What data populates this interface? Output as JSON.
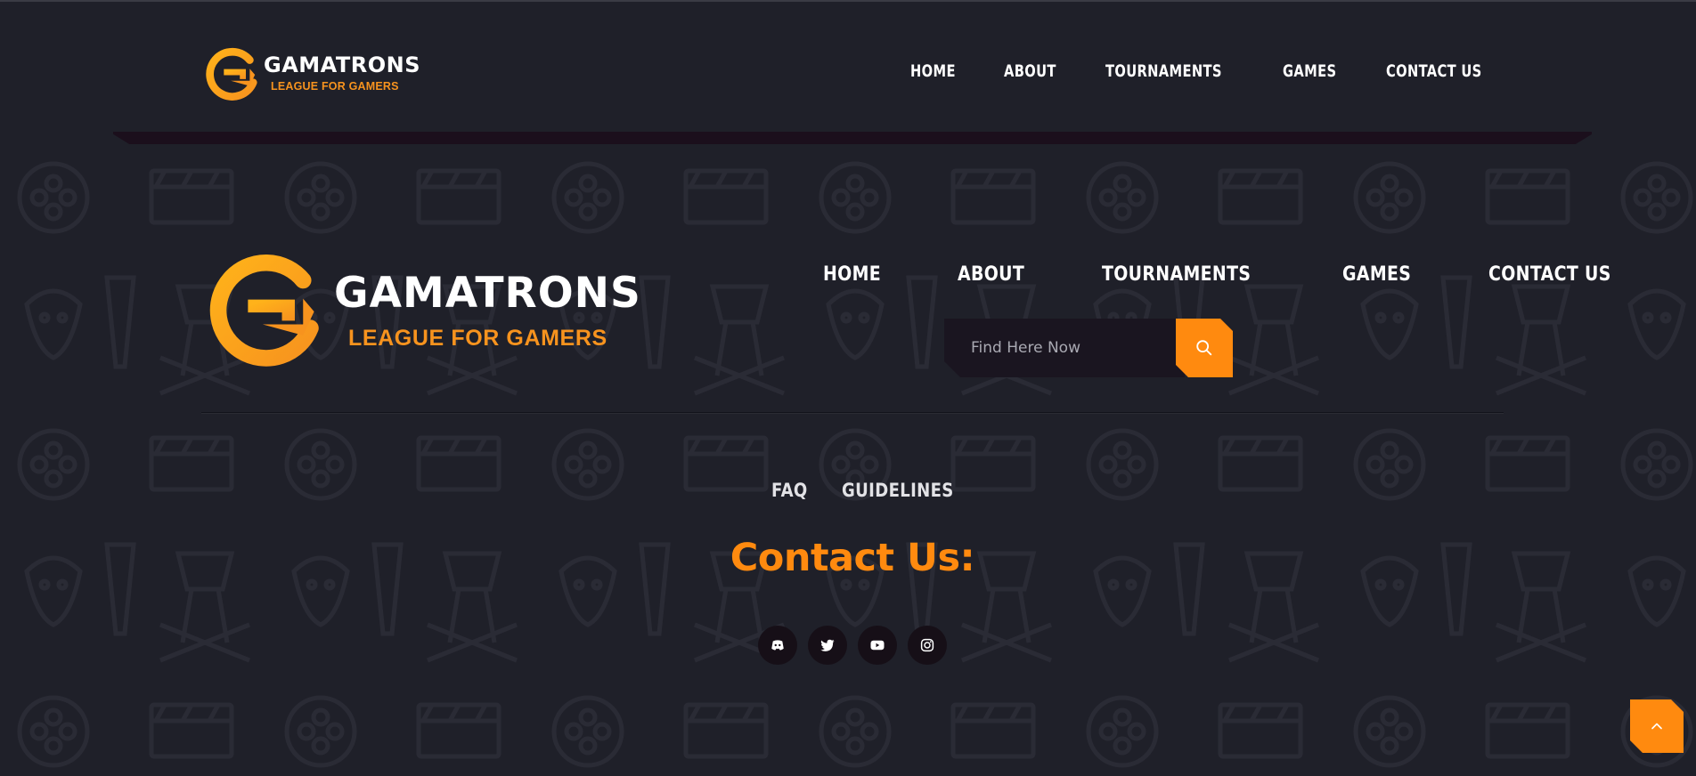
{
  "brand": {
    "name": "GAMATRONS",
    "tagline": "LEAGUE FOR GAMERS",
    "accent": "#ff8a0f",
    "logo_gradient": [
      "#ffb21a",
      "#f7931e"
    ]
  },
  "header": {
    "nav": [
      "HOME",
      "ABOUT",
      "TOURNAMENTS",
      "GAMES",
      "CONTACT US"
    ]
  },
  "footer": {
    "nav": [
      "HOME",
      "ABOUT",
      "TOURNAMENTS",
      "GAMES",
      "CONTACT US"
    ],
    "search": {
      "placeholder": "Find Here Now",
      "icon": "search-icon"
    },
    "links": [
      "FAQ",
      "GUIDELINES"
    ],
    "contact_title": "Contact Us:",
    "socials": [
      {
        "name": "discord",
        "icon": "discord-icon"
      },
      {
        "name": "twitter",
        "icon": "twitter-icon"
      },
      {
        "name": "youtube",
        "icon": "youtube-icon"
      },
      {
        "name": "instagram",
        "icon": "instagram-icon"
      }
    ]
  },
  "back_to_top": {
    "icon": "chevron-up-icon"
  }
}
